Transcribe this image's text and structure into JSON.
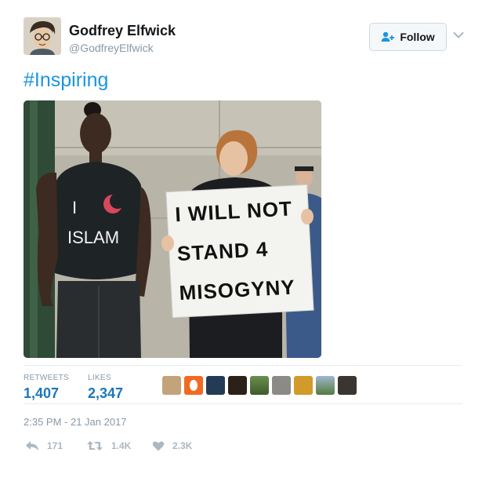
{
  "author": {
    "name": "Godfrey Elfwick",
    "handle": "@GodfreyElfwick"
  },
  "follow_button": {
    "label": "Follow",
    "icon": "add-user-icon"
  },
  "tweet": {
    "text": "#Inspiring"
  },
  "photo": {
    "shirt_lines": [
      "I",
      "ISLAM"
    ],
    "sign_lines": [
      "I WILL NOT",
      "STAND 4",
      "MISOGYNY"
    ]
  },
  "stats": {
    "retweets_label": "RETWEETS",
    "retweets_value": "1,407",
    "likes_label": "LIKES",
    "likes_value": "2,347"
  },
  "timestamp": "2:35 PM - 21 Jan 2017",
  "actions": {
    "reply_count": "171",
    "retweet_count": "1.4K",
    "like_count": "2.3K"
  },
  "colors": {
    "link": "#1b95e0",
    "stat_value": "#1d76b8",
    "muted": "#8899a6"
  }
}
